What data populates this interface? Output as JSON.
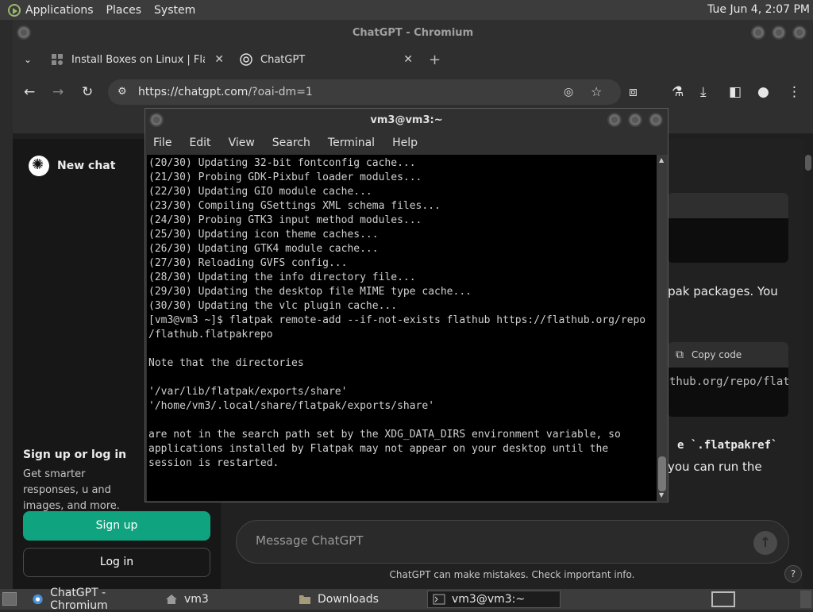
{
  "top_panel": {
    "menus": [
      "Applications",
      "Places",
      "System"
    ],
    "clock": "Tue Jun  4,  2:07 PM"
  },
  "browser": {
    "window_title": "ChatGPT - Chromium",
    "tabs": [
      {
        "label": "Install Boxes on Linux | Flathu",
        "active": false
      },
      {
        "label": "ChatGPT",
        "active": true
      }
    ],
    "url_host": "https://chatgpt.com",
    "url_path": "/?oai-dm=1"
  },
  "chatgpt": {
    "new_chat": "New chat",
    "signup_title": "Sign up or log in",
    "signup_desc": "Get smarter responses, u and images, and more.",
    "signup_button": "Sign up",
    "login_button": "Log in",
    "partial_line_1": "atpak packages. You",
    "copy_code": "Copy code",
    "code_fragment": "thub.org/repo/flath",
    "partial_line_2": "e `.flatpakref`",
    "partial_line_3": "you can run the",
    "message_placeholder": "Message ChatGPT",
    "disclaimer": "ChatGPT can make mistakes. Check important info.",
    "help": "?"
  },
  "terminal": {
    "title": "vm3@vm3:~",
    "menu": [
      "File",
      "Edit",
      "View",
      "Search",
      "Terminal",
      "Help"
    ],
    "lines": [
      "(20/30) Updating 32-bit fontconfig cache...",
      "(21/30) Probing GDK-Pixbuf loader modules...",
      "(22/30) Updating GIO module cache...",
      "(23/30) Compiling GSettings XML schema files...",
      "(24/30) Probing GTK3 input method modules...",
      "(25/30) Updating icon theme caches...",
      "(26/30) Updating GTK4 module cache...",
      "(27/30) Reloading GVFS config...",
      "(28/30) Updating the info directory file...",
      "(29/30) Updating the desktop file MIME type cache...",
      "(30/30) Updating the vlc plugin cache...",
      "[vm3@vm3 ~]$ flatpak remote-add --if-not-exists flathub https://flathub.org/repo",
      "/flathub.flatpakrepo",
      "",
      "Note that the directories",
      "",
      "'/var/lib/flatpak/exports/share'",
      "'/home/vm3/.local/share/flatpak/exports/share'",
      "",
      "are not in the search path set by the XDG_DATA_DIRS environment variable, so",
      "applications installed by Flatpak may not appear on your desktop until the",
      "session is restarted."
    ]
  },
  "taskbar": {
    "items": [
      {
        "label": "ChatGPT - Chromium",
        "active": false
      },
      {
        "label": "vm3",
        "active": false
      },
      {
        "label": "Downloads",
        "active": false
      },
      {
        "label": "vm3@vm3:~",
        "active": true
      }
    ]
  },
  "colors": {
    "accent_green": "#10a37f",
    "terminal_bg": "#000000"
  }
}
